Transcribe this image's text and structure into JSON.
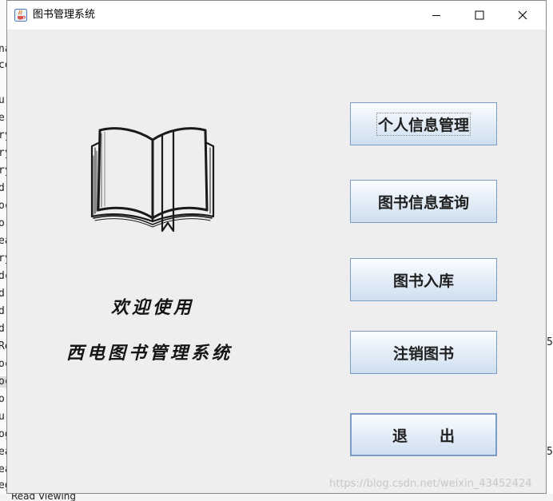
{
  "window": {
    "title": "图书管理系统"
  },
  "welcome": {
    "line1": "欢迎使用",
    "line2": "西电图书管理系统"
  },
  "buttons": {
    "personal_info": "个人信息管理",
    "book_query": "图书信息查询",
    "book_storage": "图书入库",
    "book_cancel": "注销图书",
    "exit_part1": "退",
    "exit_part2": "出"
  },
  "watermark": "https://blog.csdn.net/weixin_43452424",
  "background": {
    "left_chars": [
      "na",
      "ce",
      "",
      "u",
      "e",
      "ry",
      "ry",
      "ry",
      "dr",
      "oc",
      "or",
      "ea",
      "ry",
      "dc",
      "dr",
      "dr",
      "dr",
      "Re",
      "oc",
      "oc",
      "or",
      "ur",
      "og",
      "ea",
      "ea",
      "eg"
    ],
    "right_chars": [
      "5",
      "5"
    ],
    "bottom_text": "Read Viewing"
  },
  "icons": {
    "app": "java-coffee-icon",
    "minimize": "minimize-icon",
    "maximize": "maximize-icon",
    "close": "close-icon",
    "illustration": "open-book-icon"
  }
}
